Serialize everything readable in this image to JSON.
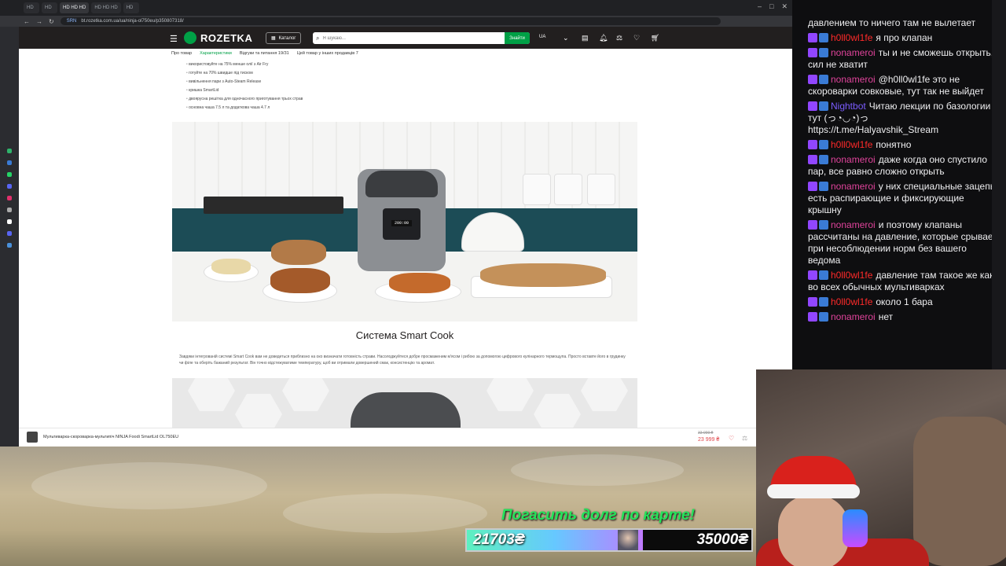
{
  "browser": {
    "tabs": [
      "HD",
      "HD",
      "HD HD HD",
      "HD HD HD",
      "HD"
    ],
    "url": "bt.rozetka.com.ua/ua/ninja-ol750eu/p350807318/",
    "url_badge": "SRN"
  },
  "rozetka": {
    "logo": "ROZETKA",
    "catalog_label": "Каталог",
    "search_placeholder": "Я шукаю...",
    "search_button": "Знайти",
    "lang": "UA",
    "tabs": [
      "Про товар",
      "Характеристики",
      "Відгуки та питання 19/31",
      "Цей товар у інших продавців 7"
    ],
    "features": [
      "використовуйте на 75% менше олії з Air Fry",
      "готуйте на 70% швидше під тиском",
      "вивільнення пари з Auto-Steam Release",
      "кришка SmartLid",
      "двоярусна решітка для одночасного приготування трьох страв",
      "основна чаша 7.5 л та додаткова чаша 4.7 л"
    ],
    "product_screen": "200:00",
    "section_title": "Система Smart Cook",
    "section_text": "Завдяки інтегрованій системі Smart Cook вам не доведеться приблизно на око визначати готовність страви. Насолоджуйтеся добре просмаженим м'ясом і рибою за допомогою цифрового кулінарного термощупа. Просто вставте його в грудинку чи філе та оберіть бажаний результат. Він точно відстежуватиме температуру, щоб ви отримали довершений смак, консистенцію та аромат.",
    "sticky": {
      "title": "Мультиварка-скороварка-мультипіч NINJA Foodi SmartLid OL750EU",
      "old_price": "33 999 ₴",
      "price": "23 999 ₴"
    }
  },
  "donation": {
    "title": "Погасить долг по карте!",
    "current": "21703₴",
    "goal": "35000₴",
    "progress": 0.62
  },
  "chat": {
    "partial": "давлением то ничего там не вылетает",
    "messages": [
      {
        "user": "h0ll0wl1fe",
        "color": "#ff2a2a",
        "text": "я про клапан"
      },
      {
        "user": "nonameroi",
        "color": "#e0439b",
        "text": "ты и не сможешь открыть, сил не хватит"
      },
      {
        "user": "nonameroi",
        "color": "#e0439b",
        "text": "@h0ll0wl1fe это не скороварки совковые, тут так не выйдет"
      },
      {
        "user": "Nightbot",
        "color": "#7b5cff",
        "text": "Читаю лекции по базологии тут (っ◔◡◔)っ https://t.me/Halyavshik_Stream"
      },
      {
        "user": "h0ll0wl1fe",
        "color": "#ff2a2a",
        "text": "понятно"
      },
      {
        "user": "nonameroi",
        "color": "#e0439b",
        "text": "даже когда оно спустило пар, все равно сложно открыть"
      },
      {
        "user": "nonameroi",
        "color": "#e0439b",
        "text": "у них специальные зацепы есть распирающие и фиксирующие крышну"
      },
      {
        "user": "nonameroi",
        "color": "#e0439b",
        "text": "и поэтому клапаны рассчитаны на давление, которые срывает при несоблюдении норм без вашего ведома"
      },
      {
        "user": "h0ll0wl1fe",
        "color": "#ff2a2a",
        "text": "давление там такое же как во всех обычных мультиварках"
      },
      {
        "user": "h0ll0wl1fe",
        "color": "#ff2a2a",
        "text": "около 1 бара"
      },
      {
        "user": "nonameroi",
        "color": "#e0439b",
        "text": "нет"
      }
    ]
  }
}
